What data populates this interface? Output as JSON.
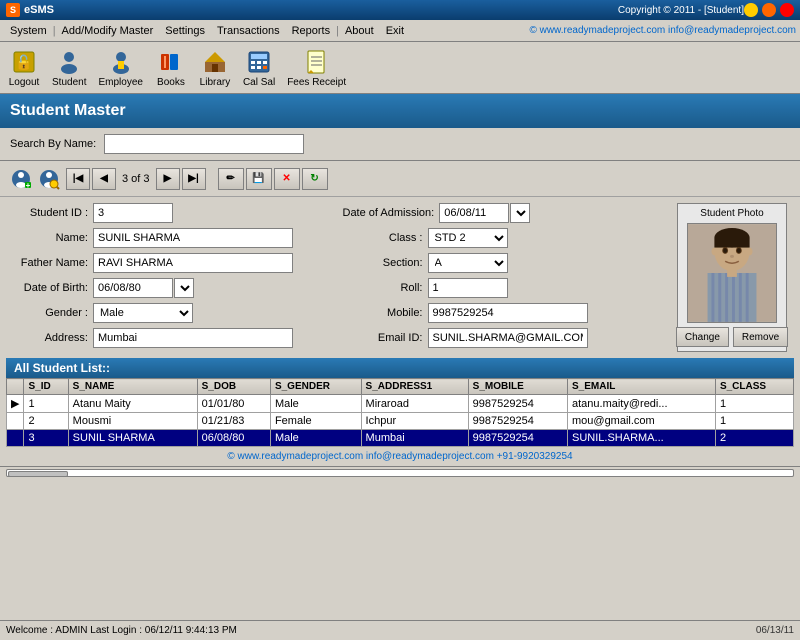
{
  "titlebar": {
    "icon": "S",
    "text": "eSMS",
    "copyright": "Copyright © 2011 - [Student]"
  },
  "menubar": {
    "items": [
      "System",
      "|",
      "Add/Modify Master",
      "Settings",
      "Transactions",
      "Reports",
      "|",
      "About",
      "Exit"
    ],
    "watermark": "© www.readymadeproject.com  info@readymadeproject.com"
  },
  "toolbar": {
    "buttons": [
      {
        "label": "Logout",
        "icon": "🔓"
      },
      {
        "label": "Student",
        "icon": "👤"
      },
      {
        "label": "Employee",
        "icon": "👤"
      },
      {
        "label": "Books",
        "icon": "📚"
      },
      {
        "label": "Library",
        "icon": "🏛"
      },
      {
        "label": "Cal Sal",
        "icon": "🖩"
      },
      {
        "label": "Fees Receipt",
        "icon": "🧾"
      }
    ]
  },
  "page": {
    "title": "Student Master"
  },
  "search": {
    "label": "Search By Name:"
  },
  "nav": {
    "count": "3 of 3"
  },
  "form": {
    "student_id_label": "Student ID :",
    "student_id": "3",
    "name_label": "Name:",
    "name": "SUNIL SHARMA",
    "father_name_label": "Father Name:",
    "father_name": "RAVI SHARMA",
    "dob_label": "Date of Birth:",
    "dob": "06/08/80",
    "gender_label": "Gender :",
    "gender": "Male",
    "address_label": "Address:",
    "address": "Mumbai",
    "doa_label": "Date of Admission:",
    "doa": "06/08/11",
    "class_label": "Class :",
    "class": "STD 2",
    "section_label": "Section:",
    "section": "A",
    "roll_label": "Roll:",
    "roll": "1",
    "mobile_label": "Mobile:",
    "mobile": "9987529254",
    "email_label": "Email ID:",
    "email": "SUNIL.SHARMA@GMAIL.COM",
    "photo_label": "Student Photo",
    "change_btn": "Change",
    "remove_btn": "Remove"
  },
  "student_list": {
    "header": "All Student List::",
    "columns": [
      "",
      "S_ID",
      "S_NAME",
      "S_DOB",
      "S_GENDER",
      "S_ADDRESS1",
      "S_MOBILE",
      "S_EMAIL",
      "S_CLASS"
    ],
    "rows": [
      {
        "indicator": "▶",
        "id": "1",
        "name": "Atanu Maity",
        "dob": "01/01/80",
        "gender": "Male",
        "address": "Miraroad",
        "mobile": "9987529254",
        "email": "atanu.maity@redi...",
        "class_val": "1",
        "selected": false
      },
      {
        "indicator": "",
        "id": "2",
        "name": "Mousmi",
        "dob": "01/21/83",
        "gender": "Female",
        "address": "Ichpur",
        "mobile": "9987529254",
        "email": "mou@gmail.com",
        "class_val": "1",
        "selected": false
      },
      {
        "indicator": "",
        "id": "3",
        "name": "SUNIL SHARMA",
        "dob": "06/08/80",
        "gender": "Male",
        "address": "Mumbai",
        "mobile": "9987529254",
        "email": "SUNIL.SHARMA...",
        "class_val": "2",
        "selected": true
      }
    ]
  },
  "footer": {
    "watermark": "© www.readymadeproject.com  info@readymadeproject.com  +91-9920329254",
    "status": "Welcome : ADMIN  Last Login : 06/12/11 9:44:13 PM",
    "date": "06/13/11"
  }
}
